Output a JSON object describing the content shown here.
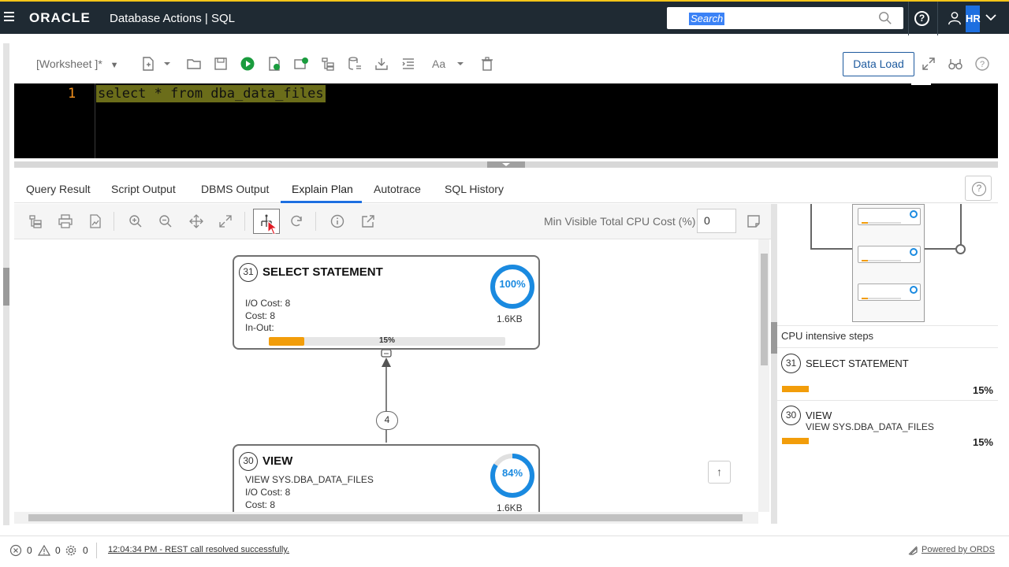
{
  "header": {
    "brand": "ORACLE",
    "app_title": "Database Actions |  SQL",
    "search_placeholder": "Search",
    "search_highlight": "Search",
    "user_initials": "HR"
  },
  "worksheet": {
    "selector_label": "[Worksheet ]*",
    "data_load_label": "Data Load"
  },
  "editor": {
    "line_number": "1",
    "code": "select * from dba_data_files"
  },
  "tabs": [
    {
      "label": "Query Result"
    },
    {
      "label": "Script Output"
    },
    {
      "label": "DBMS Output"
    },
    {
      "label": "Explain Plan"
    },
    {
      "label": "Autotrace"
    },
    {
      "label": "SQL History"
    }
  ],
  "active_tab": "Explain Plan",
  "plan_toolbar": {
    "min_cost_label": "Min Visible Total CPU Cost (%)",
    "min_cost_value": "0"
  },
  "nodes": [
    {
      "id": "31",
      "title": "SELECT STATEMENT",
      "subtitle": "",
      "lines": [
        "I/O Cost: 8",
        "Cost: 8",
        "In-Out:"
      ],
      "donut_label": "100%",
      "donut_fraction": 1.0,
      "size": "1.6KB",
      "bar_label": "15%",
      "bar_fraction": 0.15
    },
    {
      "id": "30",
      "title": "VIEW",
      "subtitle": "VIEW SYS.DBA_DATA_FILES",
      "lines": [
        "I/O Cost: 8",
        "Cost: 8"
      ],
      "donut_label": "84%",
      "donut_fraction": 0.84,
      "size": "1.6KB"
    }
  ],
  "edge_label": "4",
  "right_panel": {
    "title": "CPU intensive steps",
    "items": [
      {
        "id": "31",
        "title": "SELECT STATEMENT",
        "subtitle": "",
        "percent": "15%"
      },
      {
        "id": "30",
        "title": "VIEW",
        "subtitle": "VIEW SYS.DBA_DATA_FILES",
        "percent": "15%"
      }
    ]
  },
  "status": {
    "errors": "0",
    "warnings": "0",
    "tasks": "0",
    "message": "12:04:34 PM - REST call resolved successfully.",
    "powered_by": "Powered by ORDS"
  },
  "colors": {
    "header_bg": "#1f2a33",
    "accent": "#1d6fe0",
    "bar": "#f29d0a",
    "donut": "#1a8ae0",
    "run_green": "#1a9c3e"
  }
}
